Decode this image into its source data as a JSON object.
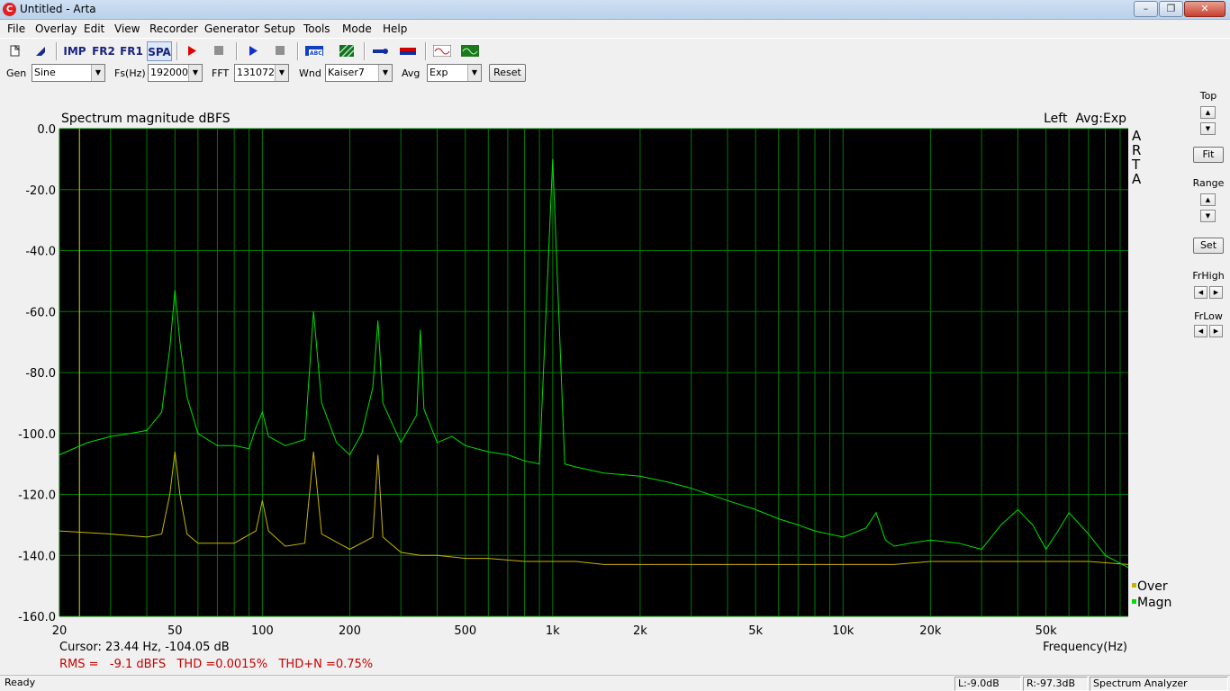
{
  "window": {
    "title": "Untitled - Arta",
    "app_icon": "arta-logo-icon"
  },
  "menu": [
    "File",
    "Overlay",
    "Edit",
    "View",
    "Recorder",
    "Generator",
    "Setup",
    "Tools",
    "Mode",
    "Help"
  ],
  "toolbar": {
    "buttons": [
      {
        "name": "new-file-icon"
      },
      {
        "name": "open-file-icon"
      },
      {
        "label": "IMP"
      },
      {
        "label": "FR2"
      },
      {
        "label": "FR1"
      },
      {
        "label": "SPA"
      },
      {
        "name": "record-icon"
      },
      {
        "name": "stop-icon"
      },
      {
        "name": "play-icon"
      },
      {
        "name": "stop-icon"
      },
      {
        "name": "abc-icon"
      },
      {
        "name": "hatch-icon"
      },
      {
        "name": "probe-icon"
      },
      {
        "name": "flag-icon"
      },
      {
        "name": "signal-icon"
      },
      {
        "name": "scope-icon"
      }
    ]
  },
  "controls": {
    "gen_label": "Gen",
    "gen_value": "Sine",
    "fs_label": "Fs(Hz)",
    "fs_value": "192000",
    "fft_label": "FFT",
    "fft_value": "131072",
    "wnd_label": "Wnd",
    "wnd_value": "Kaiser7",
    "avg_label": "Avg",
    "avg_value": "Exp",
    "reset_label": "Reset"
  },
  "plot": {
    "title": "Spectrum magnitude dBFS",
    "channel_info": "Left  Avg:Exp",
    "arta_letters": [
      "A",
      "R",
      "T",
      "A"
    ],
    "y_ticks": [
      "0.0",
      "-20.0",
      "-40.0",
      "-60.0",
      "-80.0",
      "-100.0",
      "-120.0",
      "-140.0",
      "-160.0"
    ],
    "x_ticks": [
      "20",
      "50",
      "100",
      "200",
      "500",
      "1k",
      "2k",
      "5k",
      "10k",
      "20k",
      "50k"
    ],
    "x_axis_label": "Frequency(Hz)",
    "cursor_text": "Cursor: 23.44 Hz, -104.05 dB",
    "metrics_text": "RMS =   -9.1 dBFS   THD =0.0015%   THD+N =0.75%",
    "legend": [
      {
        "label": "Over",
        "color": "#c8b400"
      },
      {
        "label": "Magn",
        "color": "#00e000"
      }
    ],
    "colors": {
      "background": "#000000",
      "grid": "#007a00",
      "magn": "#00e000",
      "over": "#c8b400",
      "cursor_line": "#d8d800",
      "metrics": "#c80000"
    }
  },
  "chart_data": {
    "type": "line",
    "title": "Spectrum magnitude dBFS",
    "xlabel": "Frequency(Hz)",
    "ylabel": "",
    "x_scale": "log",
    "xlim": [
      20,
      96000
    ],
    "ylim": [
      -160,
      0
    ],
    "grid": true,
    "legend_position": "bottom-right",
    "cursor_x": 23.44,
    "series": [
      {
        "name": "Magn",
        "x": [
          20,
          25,
          30,
          35,
          40,
          45,
          48,
          50,
          52,
          55,
          60,
          70,
          80,
          90,
          95,
          100,
          105,
          120,
          140,
          150,
          160,
          180,
          200,
          220,
          240,
          250,
          260,
          300,
          340,
          350,
          360,
          400,
          450,
          500,
          600,
          700,
          800,
          900,
          1000,
          1100,
          1200,
          1500,
          2000,
          2500,
          3000,
          4000,
          5000,
          6000,
          7000,
          8000,
          10000,
          12000,
          13000,
          14000,
          15000,
          17000,
          20000,
          25000,
          30000,
          35000,
          40000,
          45000,
          50000,
          55000,
          60000,
          70000,
          80000,
          96000
        ],
        "y": [
          -107,
          -103,
          -101,
          -100,
          -99,
          -93,
          -72,
          -53,
          -70,
          -88,
          -100,
          -104,
          -104,
          -105,
          -98,
          -93,
          -101,
          -104,
          -102,
          -60,
          -90,
          -103,
          -107,
          -100,
          -85,
          -63,
          -90,
          -103,
          -94,
          -66,
          -92,
          -103,
          -101,
          -104,
          -106,
          -107,
          -109,
          -110,
          -10,
          -110,
          -111,
          -113,
          -114,
          -116,
          -118,
          -122,
          -125,
          -128,
          -130,
          -132,
          -134,
          -131,
          -126,
          -135,
          -137,
          -136,
          -135,
          -136,
          -138,
          -130,
          -125,
          -130,
          -138,
          -132,
          -126,
          -133,
          -140,
          -144
        ]
      },
      {
        "name": "Over",
        "x": [
          20,
          30,
          40,
          45,
          48,
          50,
          52,
          55,
          60,
          80,
          95,
          100,
          105,
          120,
          140,
          150,
          160,
          200,
          240,
          250,
          260,
          300,
          350,
          400,
          500,
          600,
          800,
          1000,
          1200,
          1500,
          2000,
          3000,
          5000,
          7000,
          10000,
          15000,
          20000,
          30000,
          40000,
          50000,
          70000,
          96000
        ],
        "y": [
          -132,
          -133,
          -134,
          -133,
          -120,
          -106,
          -120,
          -133,
          -136,
          -136,
          -132,
          -122,
          -132,
          -137,
          -136,
          -106,
          -133,
          -138,
          -134,
          -107,
          -134,
          -139,
          -140,
          -140,
          -141,
          -141,
          -142,
          -142,
          -142,
          -143,
          -143,
          -143,
          -143,
          -143,
          -143,
          -143,
          -142,
          -142,
          -142,
          -142,
          -142,
          -143
        ]
      }
    ]
  },
  "side_panel": {
    "top_label": "Top",
    "fit_label": "Fit",
    "range_label": "Range",
    "set_label": "Set",
    "frhigh_label": "FrHigh",
    "frlow_label": "FrLow"
  },
  "status": {
    "left": "Ready",
    "level_left": "L:-9.0dB",
    "level_right": "R:-97.3dB",
    "mode": "Spectrum Analyzer"
  }
}
